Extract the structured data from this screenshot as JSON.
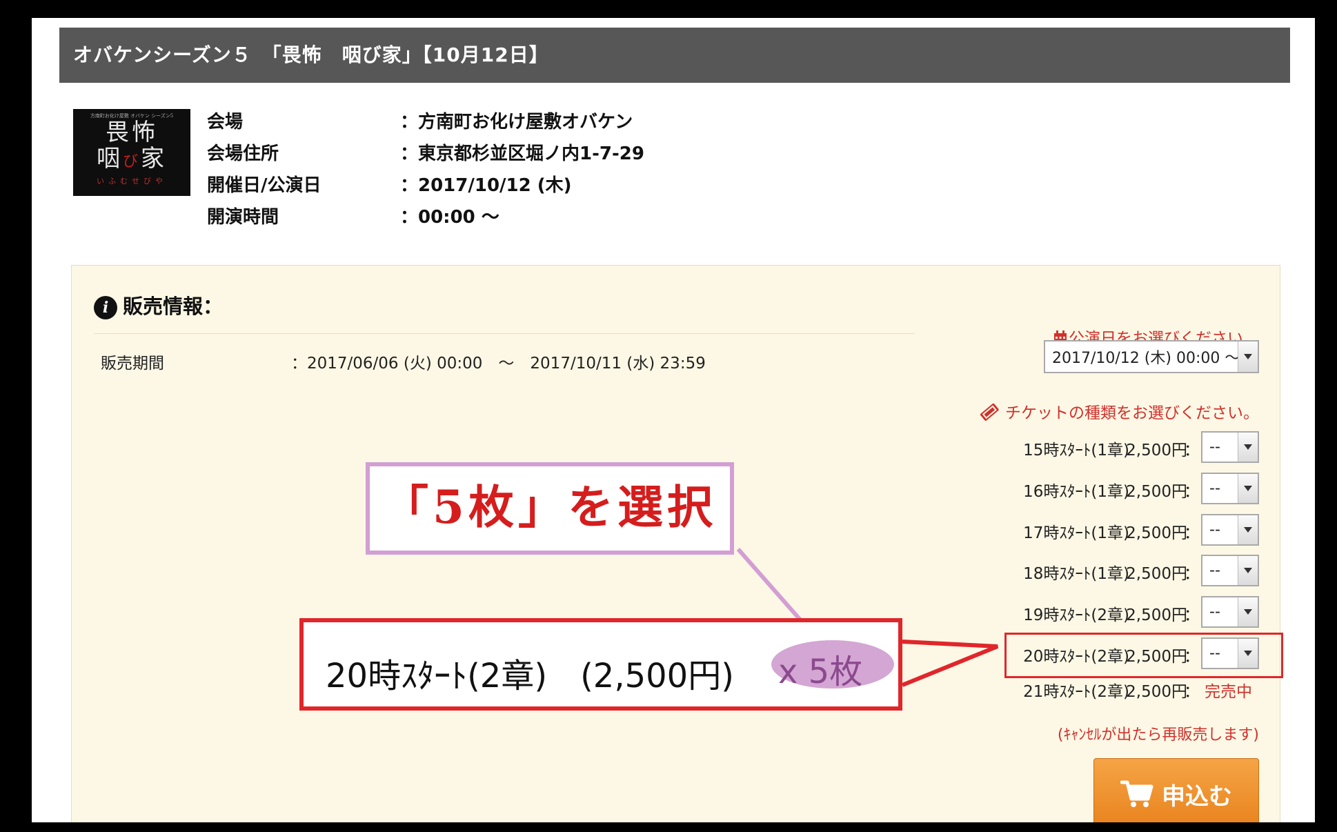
{
  "event": {
    "title": "オバケンシーズン５　「畏怖　咽び家」【10月12日】",
    "thumbnail": {
      "small_text": "方南町お化け屋敷 オバケン シーズン5",
      "line1": "畏怖",
      "line2a": "咽",
      "line2b": "び",
      "line2c": "家",
      "sub": "いふむせびや"
    },
    "details": [
      {
        "label": "会場",
        "value": "：方南町お化け屋敷オバケン"
      },
      {
        "label": "会場住所",
        "value": "：東京都杉並区堀ノ内1-7-29"
      },
      {
        "label": "開催日/公演日",
        "value": "：2017/10/12 (木)"
      },
      {
        "label": "開演時間",
        "value": "：00:00 ～"
      }
    ]
  },
  "sales": {
    "heading": "販売情報：",
    "period_label": "販売期間",
    "period_value": "：2017/06/06 (火) 00:00　～　2017/10/11 (水) 23:59",
    "date_prompt": "公演日をお選びください。",
    "date_select": "2017/10/12 (木) 00:00 ～",
    "ticket_prompt": "チケットの種類をお選びください。",
    "tickets": [
      {
        "name": "15時ｽﾀｰﾄ(1章)",
        "price": "2,500円",
        "qty": "--"
      },
      {
        "name": "16時ｽﾀｰﾄ(1章)",
        "price": "2,500円",
        "qty": "--"
      },
      {
        "name": "17時ｽﾀｰﾄ(1章)",
        "price": "2,500円",
        "qty": "--"
      },
      {
        "name": "18時ｽﾀｰﾄ(1章)",
        "price": "2,500円",
        "qty": "--"
      },
      {
        "name": "19時ｽﾀｰﾄ(2章)",
        "price": "2,500円",
        "qty": "--"
      },
      {
        "name": "20時ｽﾀｰﾄ(2章)",
        "price": "2,500円",
        "qty": "--"
      },
      {
        "name": "21時ｽﾀｰﾄ(2章)",
        "price": "2,500円",
        "status": "完売中"
      }
    ],
    "cancel_note": "(ｷｬﾝｾﾙが出たら再販売します)",
    "apply_label": "申込む",
    "colon": "："
  },
  "annotation": {
    "callout": "「5枚」を選択",
    "result_text": "20時ｽﾀｰﾄ(2章)　(2,500円)",
    "result_qty": "x 5枚"
  },
  "colors": {
    "accent_red": "#d0312d",
    "highlight_red": "#e0262b",
    "callout_border": "#d29ed3",
    "apply_orange": "#e8821c",
    "panel_bg": "#fdf8e5",
    "title_bar": "#575757"
  }
}
